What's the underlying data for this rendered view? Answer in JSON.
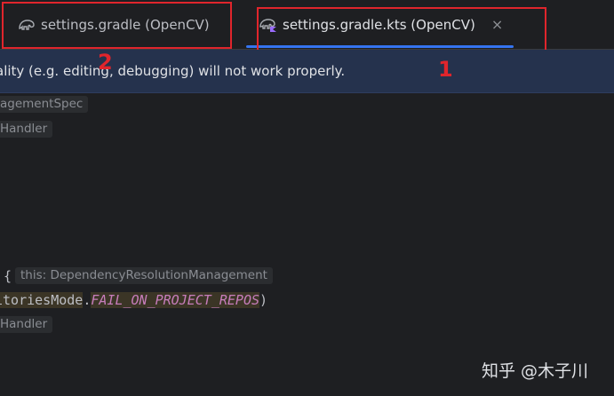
{
  "tabs": [
    {
      "label": "settings.gradle (OpenCV)",
      "icon": "gradle-elephant-icon",
      "active": false
    },
    {
      "label": "settings.gradle.kts (OpenCV)",
      "icon": "gradle-kotlin-icon",
      "active": true,
      "close": "×"
    }
  ],
  "annotations": {
    "one": "1",
    "two": "2"
  },
  "banner": {
    "text": "ality (e.g. editing, debugging) will not work properly."
  },
  "editor": {
    "hint1": "agementSpec",
    "hint2": "Handler",
    "brace": "{",
    "hint3": "this: DependencyResolutionManagement",
    "line_ident": "itoriesMode",
    "line_dot": ".",
    "line_const": "FAIL_ON_PROJECT_REPOS",
    "line_close": ")",
    "hint4": "Handler"
  },
  "watermark": "知乎 @木子川",
  "colors": {
    "accent": "#3574f0",
    "annotation": "#e0252c",
    "banner_bg": "#25324d"
  }
}
